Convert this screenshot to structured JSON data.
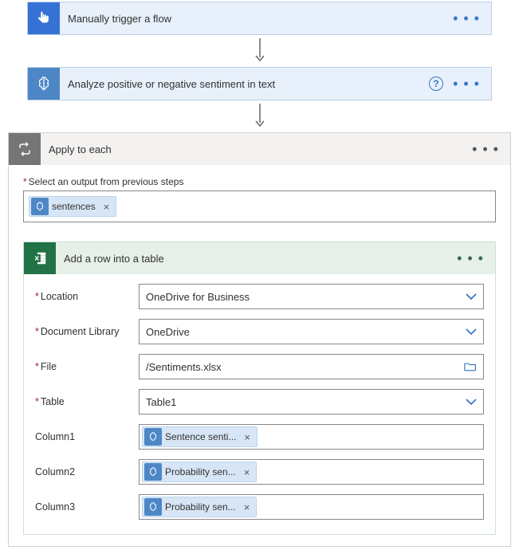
{
  "step1": {
    "title": "Manually trigger a flow"
  },
  "step2": {
    "title": "Analyze positive or negative sentiment in text"
  },
  "loop": {
    "title": "Apply to each",
    "outputLabel": "Select an output from previous steps",
    "token": "sentences"
  },
  "action": {
    "title": "Add a row into a table",
    "fields": {
      "location": {
        "label": "Location",
        "value": "OneDrive for Business"
      },
      "documentLibrary": {
        "label": "Document Library",
        "value": "OneDrive"
      },
      "file": {
        "label": "File",
        "value": "/Sentiments.xlsx"
      },
      "table": {
        "label": "Table",
        "value": "Table1"
      },
      "col1": {
        "label": "Column1",
        "token": "Sentence senti..."
      },
      "col2": {
        "label": "Column2",
        "token": "Probability sen..."
      },
      "col3": {
        "label": "Column3",
        "token": "Probability sen..."
      }
    }
  }
}
